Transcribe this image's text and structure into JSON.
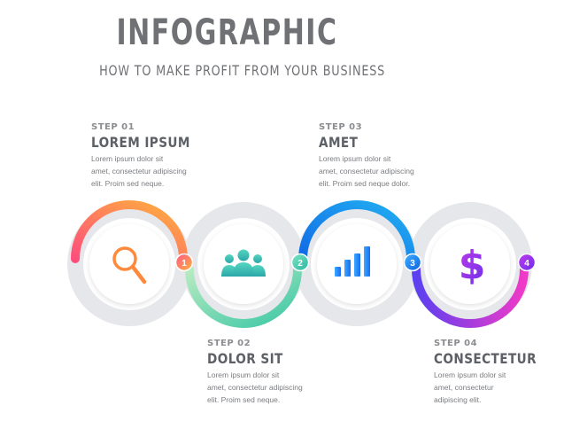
{
  "header": {
    "title": "INFOGRAPHIC",
    "subtitle": "HOW TO MAKE PROFIT FROM YOUR BUSINESS"
  },
  "steps": [
    {
      "number": "1",
      "label": "STEP 01",
      "title": "LOREM IPSUM",
      "body": "Lorem ipsum dolor sit\namet, consectetur adipiscing\nelit. Proim sed neque.",
      "icon": "search-icon",
      "color": "#ff8a3d"
    },
    {
      "number": "2",
      "label": "STEP 02",
      "title": "DOLOR SIT",
      "body": "Lorem ipsum dolor sit\namet, consectetur adipiscing\nelit. Proim sed neque.",
      "icon": "users-icon",
      "color": "#3cc7a6"
    },
    {
      "number": "3",
      "label": "STEP 03",
      "title": "AMET",
      "body": "Lorem ipsum dolor sit\namet, consectetur adipiscing\nelit. Proim sed neque dolor.",
      "icon": "bar-chart-icon",
      "color": "#1a84e8"
    },
    {
      "number": "4",
      "label": "STEP 04",
      "title": "CONSECTETUR",
      "body": "Lorem ipsum dolor sit\namet, consectetur\nadipiscing elit.",
      "icon": "dollar-icon",
      "color": "#b03ae6"
    }
  ],
  "colors": {
    "title_text": "#6f7175",
    "step_title": "#5d6066",
    "ring_gray": "#e6e7ea",
    "gradient_1": [
      "#ff4e7c",
      "#ffb23c"
    ],
    "gradient_2": [
      "#4fd3b6",
      "#b8ebc0"
    ],
    "gradient_3": [
      "#1169e6",
      "#22a6f2"
    ],
    "gradient_4": [
      "#5b3ff0",
      "#f03ac8"
    ]
  }
}
